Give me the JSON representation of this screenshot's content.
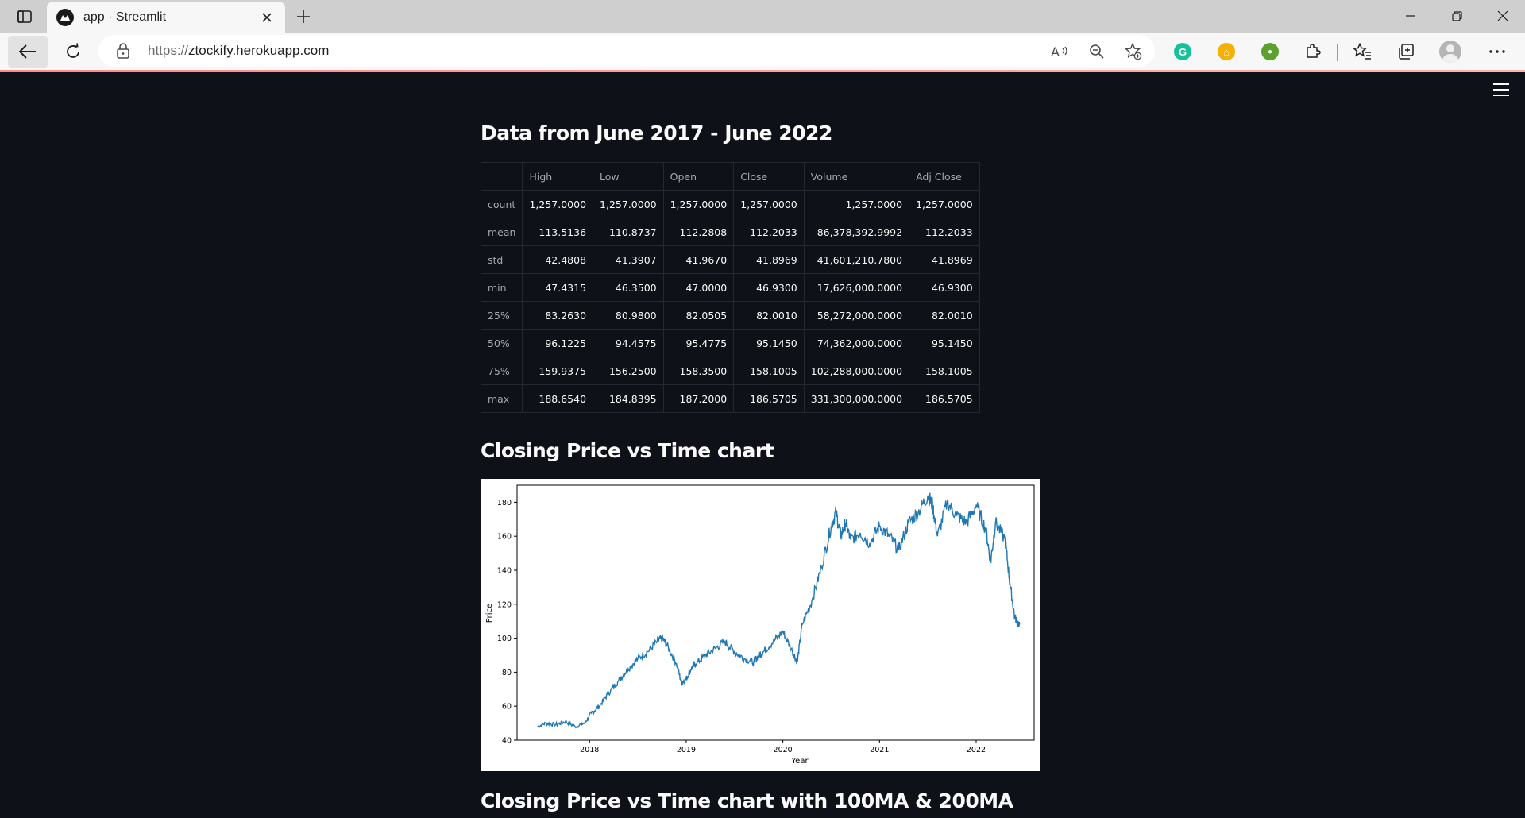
{
  "browser": {
    "tab_title": "app · Streamlit",
    "url_scheme": "https://",
    "url_host": "ztockify.herokuapp.com",
    "extensions": [
      {
        "name": "grammarly",
        "color": "#15c39a",
        "glyph": "G"
      },
      {
        "name": "home-ext",
        "color": "#f6b100",
        "glyph": "⌂"
      },
      {
        "name": "green-ext",
        "color": "#5ca12d",
        "glyph": "●"
      }
    ]
  },
  "main": {
    "section1_title": "Data from June 2017 - June 2022",
    "table": {
      "columns": [
        "",
        "High",
        "Low",
        "Open",
        "Close",
        "Volume",
        "Adj Close"
      ],
      "rows": [
        {
          "label": "count",
          "values": [
            "1,257.0000",
            "1,257.0000",
            "1,257.0000",
            "1,257.0000",
            "1,257.0000",
            "1,257.0000"
          ]
        },
        {
          "label": "mean",
          "values": [
            "113.5136",
            "110.8737",
            "112.2808",
            "112.2033",
            "86,378,392.9992",
            "112.2033"
          ]
        },
        {
          "label": "std",
          "values": [
            "42.4808",
            "41.3907",
            "41.9670",
            "41.8969",
            "41,601,210.7800",
            "41.8969"
          ]
        },
        {
          "label": "min",
          "values": [
            "47.4315",
            "46.3500",
            "47.0000",
            "46.9300",
            "17,626,000.0000",
            "46.9300"
          ]
        },
        {
          "label": "25%",
          "values": [
            "83.2630",
            "80.9800",
            "82.0505",
            "82.0010",
            "58,272,000.0000",
            "82.0010"
          ]
        },
        {
          "label": "50%",
          "values": [
            "96.1225",
            "94.4575",
            "95.4775",
            "95.1450",
            "74,362,000.0000",
            "95.1450"
          ]
        },
        {
          "label": "75%",
          "values": [
            "159.9375",
            "156.2500",
            "158.3500",
            "158.1005",
            "102,288,000.0000",
            "158.1005"
          ]
        },
        {
          "label": "max",
          "values": [
            "188.6540",
            "184.8395",
            "187.2000",
            "186.5705",
            "331,300,000.0000",
            "186.5705"
          ]
        }
      ]
    },
    "section2_title": "Closing Price vs Time chart",
    "section3_title": "Closing Price vs Time chart with 100MA & 200MA"
  },
  "chart_data": {
    "type": "line",
    "title": "",
    "xlabel": "Year",
    "ylabel": "Price",
    "xlim": [
      2017.25,
      2022.6
    ],
    "ylim": [
      40,
      190
    ],
    "xticks": [
      2018,
      2019,
      2020,
      2021,
      2022
    ],
    "yticks": [
      40,
      60,
      80,
      100,
      120,
      140,
      160,
      180
    ],
    "grid": false,
    "series": [
      {
        "color": "#1f77b4",
        "x": [
          2017.46,
          2017.55,
          2017.65,
          2017.75,
          2017.85,
          2017.95,
          2018.02,
          2018.1,
          2018.2,
          2018.3,
          2018.4,
          2018.5,
          2018.6,
          2018.7,
          2018.75,
          2018.8,
          2018.9,
          2018.95,
          2019.0,
          2019.05,
          2019.1,
          2019.2,
          2019.3,
          2019.4,
          2019.5,
          2019.6,
          2019.7,
          2019.75,
          2019.8,
          2019.9,
          2020.0,
          2020.1,
          2020.15,
          2020.2,
          2020.3,
          2020.4,
          2020.5,
          2020.55,
          2020.6,
          2020.65,
          2020.7,
          2020.8,
          2020.9,
          2021.0,
          2021.1,
          2021.2,
          2021.3,
          2021.4,
          2021.5,
          2021.55,
          2021.6,
          2021.7,
          2021.8,
          2021.9,
          2022.0,
          2022.1,
          2022.15,
          2022.2,
          2022.3,
          2022.35,
          2022.4,
          2022.45
        ],
        "y": [
          48,
          50,
          49,
          51,
          48,
          50,
          56,
          60,
          68,
          75,
          82,
          88,
          92,
          98,
          100,
          96,
          85,
          74,
          76,
          82,
          85,
          90,
          94,
          98,
          92,
          88,
          86,
          90,
          92,
          98,
          104,
          92,
          86,
          108,
          122,
          142,
          166,
          174,
          160,
          168,
          158,
          162,
          156,
          166,
          160,
          152,
          168,
          174,
          184,
          178,
          160,
          180,
          172,
          168,
          178,
          164,
          145,
          168,
          158,
          132,
          112,
          108
        ]
      }
    ]
  }
}
